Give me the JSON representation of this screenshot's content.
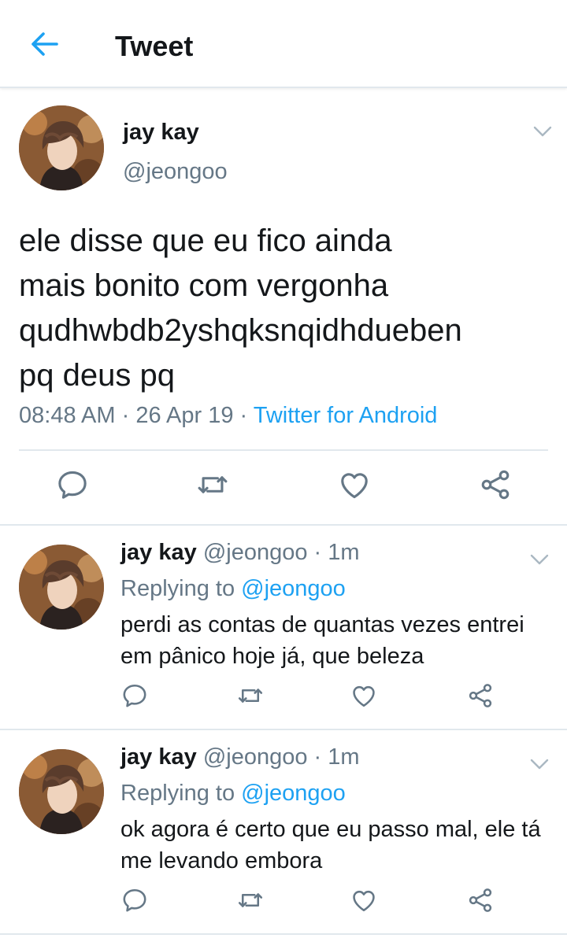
{
  "header": {
    "title": "Tweet",
    "back_icon": "arrow-left-icon"
  },
  "colors": {
    "accent": "#1da1f2",
    "muted": "#657786",
    "text": "#14171a",
    "border": "#e1e8ed"
  },
  "main_tweet": {
    "name": "jay kay",
    "handle": "@jeongoo",
    "text_lines": [
      "ele disse que eu fico ainda",
      "mais bonito com vergonha",
      "qudhwbdb2yshqksnqidhdueben",
      "pq deus pq"
    ],
    "time": "08:48 AM",
    "sep1": " · ",
    "date": "26 Apr 19",
    "sep2": " · ",
    "source": "Twitter for Android"
  },
  "replies": [
    {
      "name": "jay kay",
      "handle": "@jeongoo",
      "sep": " · ",
      "time": "1m",
      "replying_prefix": "Replying to ",
      "replying_to": "@jeongoo",
      "text_lines": [
        "perdi as contas de quantas vezes entrei",
        "em pânico hoje já, que beleza"
      ]
    },
    {
      "name": "jay kay",
      "handle": "@jeongoo",
      "sep": " · ",
      "time": "1m",
      "replying_prefix": "Replying to ",
      "replying_to": "@jeongoo",
      "text_lines": [
        "ok agora é certo que eu passo mal, ele tá",
        "me levando embora"
      ]
    }
  ],
  "action_icons": [
    "reply-icon",
    "retweet-icon",
    "like-icon",
    "share-icon"
  ]
}
